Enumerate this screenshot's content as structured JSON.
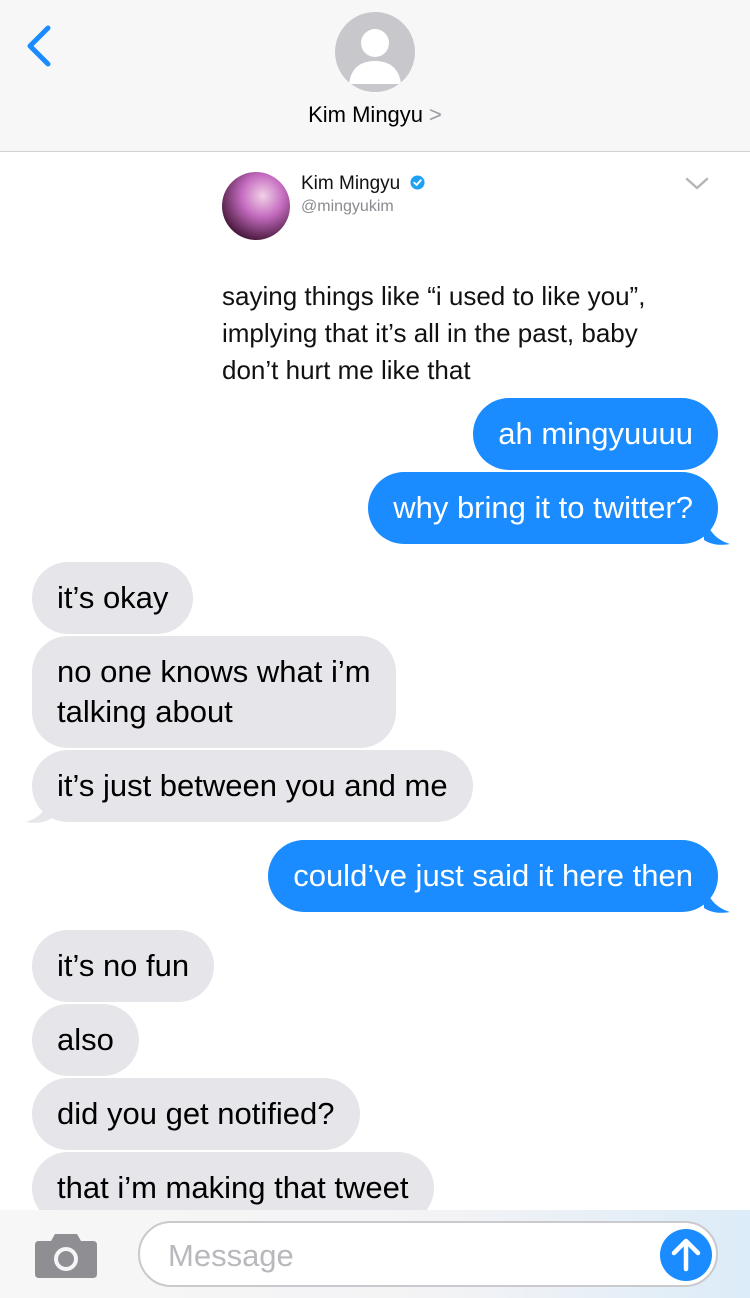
{
  "header": {
    "contact_name": "Kim Mingyu",
    "chevron": ">"
  },
  "tweet": {
    "name": "Kim Mingyu",
    "handle": "@mingyukim",
    "text": "saying things like “i used to like you”,\nimplying that it’s all in the past, baby\ndon’t hurt me like that"
  },
  "messages": [
    {
      "from": "me",
      "text": "ah mingyuuuu"
    },
    {
      "from": "me",
      "text": "why bring it to twitter?"
    },
    {
      "from": "them",
      "text": "it’s okay"
    },
    {
      "from": "them",
      "text": "no one knows what i’m\ntalking about"
    },
    {
      "from": "them",
      "text": "it’s just between you and me"
    },
    {
      "from": "me",
      "text": "could’ve just said it here then"
    },
    {
      "from": "them",
      "text": "it’s no fun"
    },
    {
      "from": "them",
      "text": "also"
    },
    {
      "from": "them",
      "text": "did you get notified?"
    },
    {
      "from": "them",
      "text": "that i’m making that tweet"
    }
  ],
  "composer": {
    "placeholder": "Message"
  },
  "colors": {
    "accent": "#1a8cff",
    "incoming_bubble": "#e5e5ea",
    "verified": "#1da1f2"
  },
  "icons": {
    "back": "chevron-left-icon",
    "contact": "person-avatar-icon",
    "verified": "verified-badge-icon",
    "tweet_menu": "chevron-down-icon",
    "camera": "camera-icon",
    "send": "arrow-up-icon"
  }
}
